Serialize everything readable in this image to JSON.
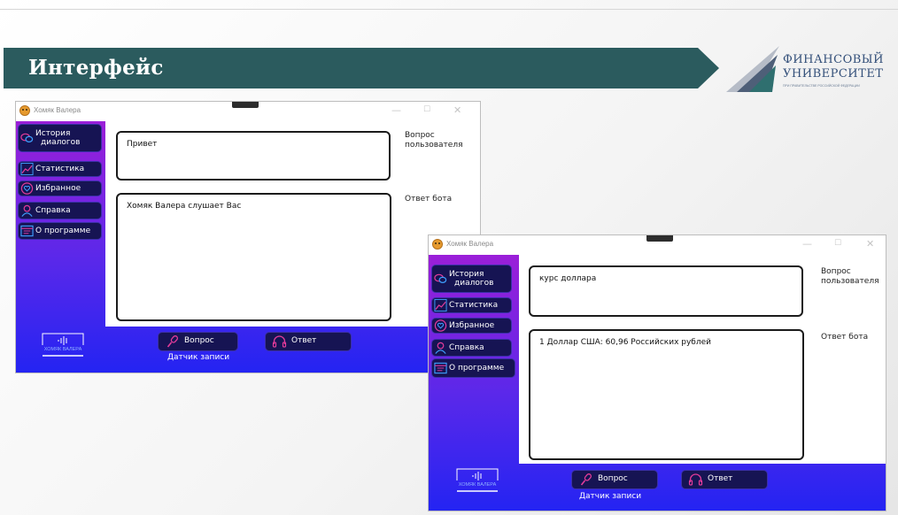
{
  "slide": {
    "title": "Интерфейс"
  },
  "logo": {
    "line1": "ФИНАНСОВЫЙ",
    "line2": "УНИВЕРСИТЕТ",
    "subtitle": "ПРИ ПРАВИТЕЛЬСТВЕ РОССИЙСКОЙ ФЕДЕРАЦИИ"
  },
  "colors": {
    "banner": "#2b5b5e",
    "nav_button": "#161453",
    "gradient_top": "#9b1fd8",
    "gradient_bottom": "#2424f2"
  },
  "app": {
    "title": "Хомяк Валера",
    "controls": {
      "minimize": "—",
      "maximize": "☐",
      "close": "✕"
    },
    "nav": [
      {
        "label_line1": "История",
        "label_line2": "диалогов",
        "icon": "chat-icon"
      },
      {
        "label": "Статистика",
        "icon": "chart-icon"
      },
      {
        "label": "Избранное",
        "icon": "heart-icon"
      },
      {
        "label": "Справка",
        "icon": "user-icon"
      },
      {
        "label": "О программе",
        "icon": "window-icon"
      }
    ],
    "labels": {
      "question": "Вопрос пользователя",
      "answer": "Ответ бота"
    },
    "buttons": {
      "ask": "Вопрос",
      "answer": "Ответ",
      "sensor": "Датчик записи"
    },
    "mini_logo": "ХОМЯК ВАЛЕРА"
  },
  "window1": {
    "question": "Привет",
    "answer": "Хомяк Валера слушает Вас"
  },
  "window2": {
    "question": "курс доллара",
    "answer": "1 Доллар США: 60,96 Российских рублей"
  }
}
